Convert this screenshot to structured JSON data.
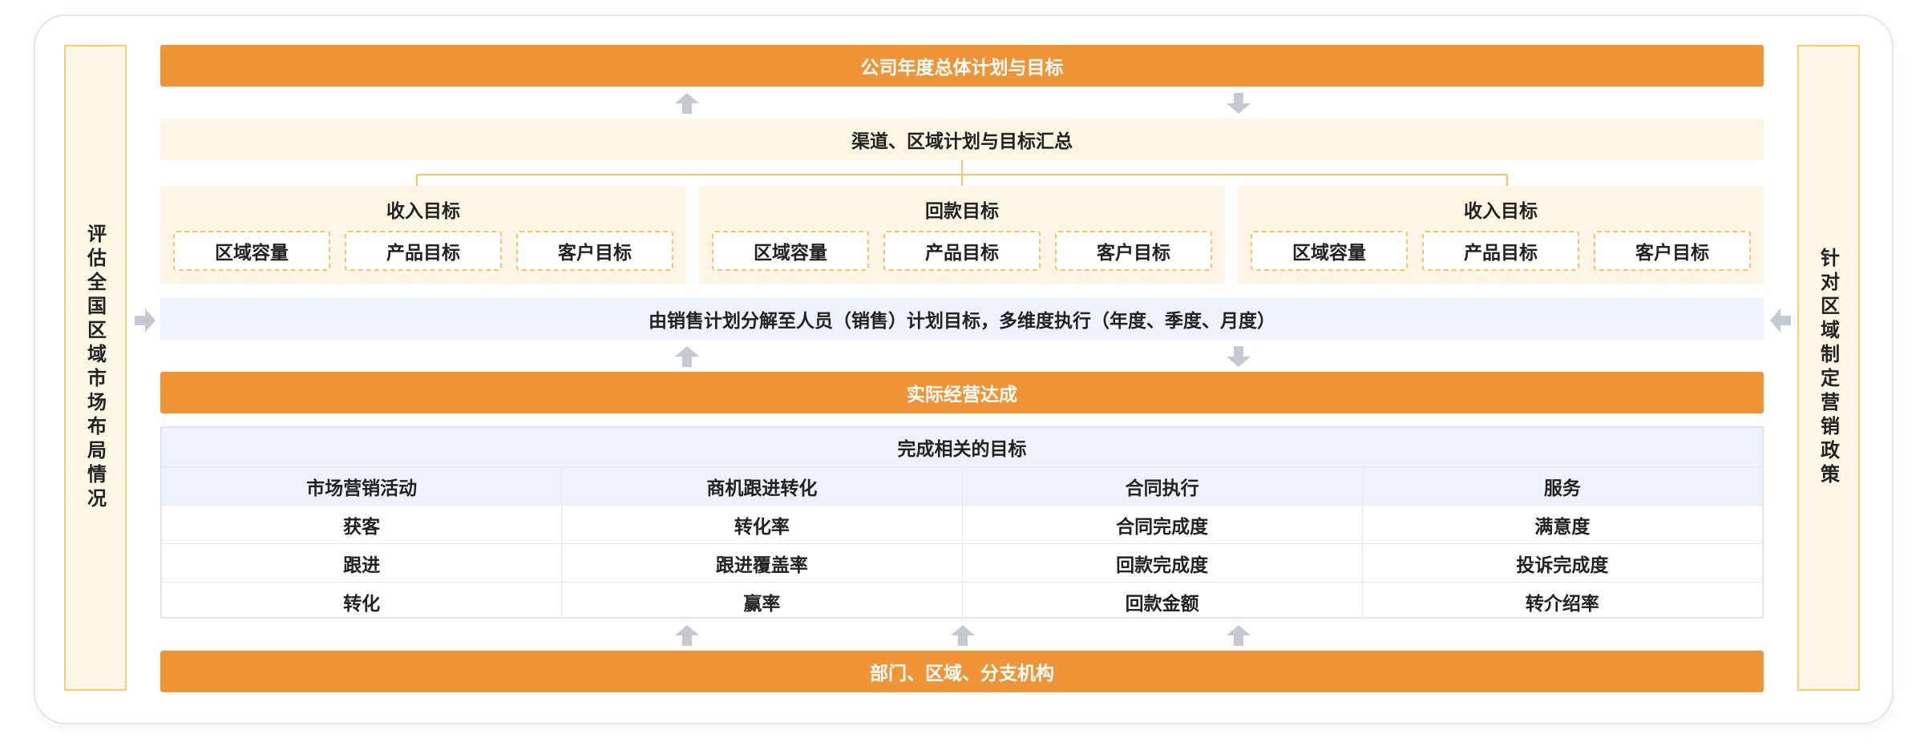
{
  "colors": {
    "accent": "#ef9437",
    "cream": "#fef6e5",
    "side_border": "#f7cf6e",
    "light_blue": "#eef2fb",
    "arrow": "#c5c9d1"
  },
  "left_side": "评估全国区域市场布局情况",
  "right_side": "针对区域制定营销政策",
  "top_bar": "公司年度总体计划与目标",
  "summary_band": "渠道、区域计划与目标汇总",
  "groups": [
    {
      "title": "收入目标",
      "items": [
        "区域容量",
        "产品目标",
        "客户目标"
      ]
    },
    {
      "title": "回款目标",
      "items": [
        "区域容量",
        "产品目标",
        "客户目标"
      ]
    },
    {
      "title": "收入目标",
      "items": [
        "区域容量",
        "产品目标",
        "客户目标"
      ]
    }
  ],
  "decompose_band": "由销售计划分解至人员（销售）计划目标，多维度执行（年度、季度、月度）",
  "achieve_bar": "实际经营达成",
  "table": {
    "title": "完成相关的目标",
    "headers": [
      "市场营销活动",
      "商机跟进转化",
      "合同执行",
      "服务"
    ],
    "rows": [
      [
        "获客",
        "转化率",
        "合同完成度",
        "满意度"
      ],
      [
        "跟进",
        "跟进覆盖率",
        "回款完成度",
        "投诉完成度"
      ],
      [
        "转化",
        "赢率",
        "回款金额",
        "转介绍率"
      ]
    ]
  },
  "bottom_bar": "部门、区域、分支机构",
  "icons": {
    "up": "arrow-up-icon",
    "down": "arrow-down-icon",
    "right": "arrow-right-icon",
    "left": "arrow-left-icon"
  }
}
